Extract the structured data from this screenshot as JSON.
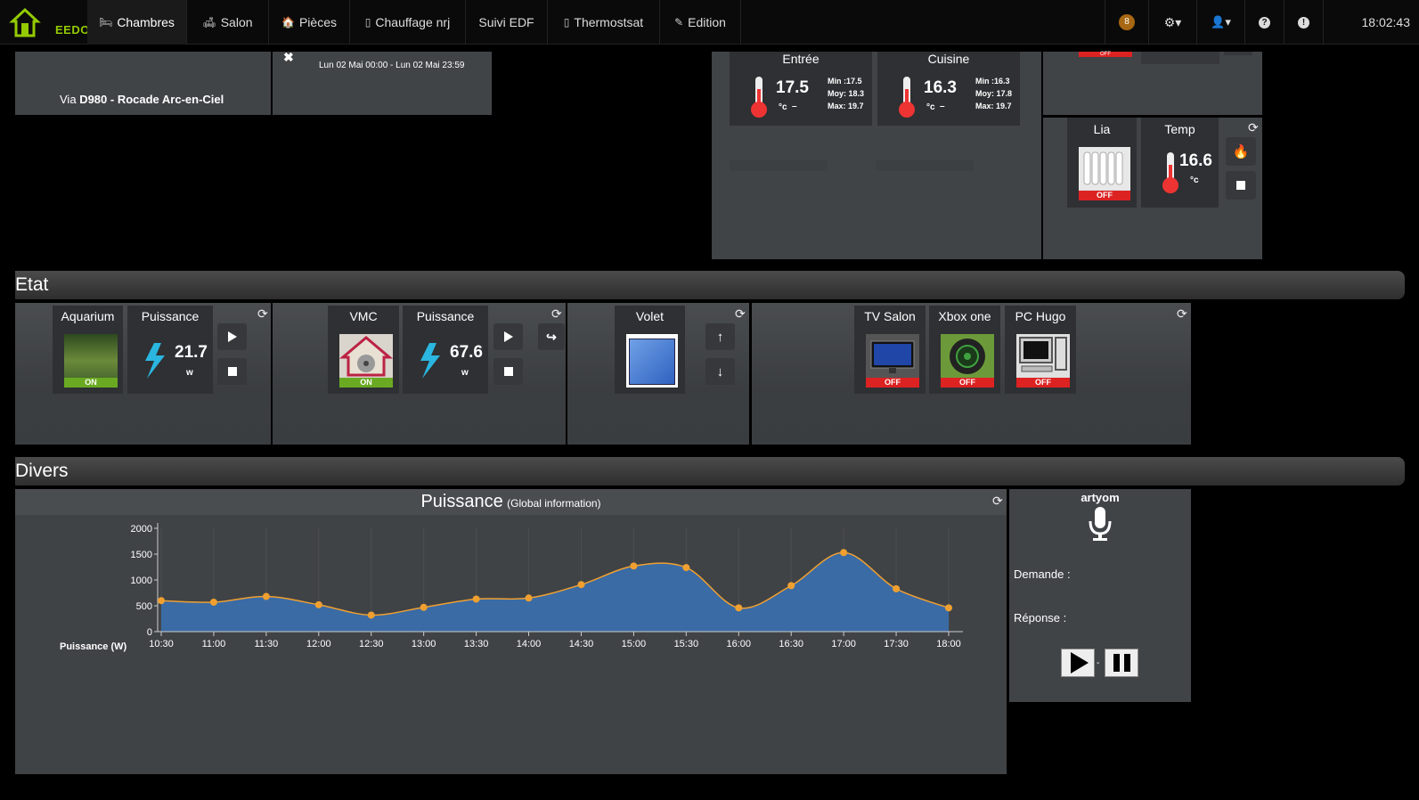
{
  "navbar": {
    "logo_text": "EEDOM",
    "items": [
      {
        "label": "Chambres",
        "glyph": "🛏"
      },
      {
        "label": "Salon",
        "glyph": "🛋"
      },
      {
        "label": "Pièces",
        "glyph": "🏠"
      },
      {
        "label": "Chauffage nrj",
        "glyph": "▯"
      },
      {
        "label": "Suivi EDF",
        "glyph": ""
      },
      {
        "label": "Thermostsat",
        "glyph": "▯"
      },
      {
        "label": "Edition",
        "glyph": "✎"
      }
    ],
    "notification_count": "8",
    "clock": "18:02:43"
  },
  "traffic": {
    "via": "Via",
    "road": "D980 - Rocade Arc-en-Ciel"
  },
  "agenda": {
    "range": "Lun 02 Mai 00:00 - Lun 02 Mai 23:59"
  },
  "temps": [
    {
      "label": "Entrée",
      "value": "17.5",
      "unit": "°c",
      "trend": "–",
      "min": "Min :17.5",
      "moy": "Moy: 18.3",
      "max": "Max: 19.7"
    },
    {
      "label": "Cuisine",
      "value": "16.3",
      "unit": "°c",
      "trend": "–",
      "min": "Min :16.3",
      "moy": "Moy: 17.8",
      "max": "Max: 19.7"
    }
  ],
  "top_right": {
    "off_label": "OFF"
  },
  "heating": {
    "lia_label": "Lia",
    "lia_state": "OFF",
    "temp_label": "Temp",
    "temp_value": "16.6",
    "temp_unit": "°c"
  },
  "etat": {
    "title": "Etat",
    "aquarium": {
      "label": "Aquarium",
      "state": "ON",
      "power_label": "Puissance",
      "power_value": "21.7",
      "power_unit": "w"
    },
    "vmc": {
      "label": "VMC",
      "state": "ON",
      "power_label": "Puissance",
      "power_value": "67.6",
      "power_unit": "w"
    },
    "volet": {
      "label": "Volet"
    },
    "devices": [
      {
        "label": "TV Salon",
        "state": "OFF"
      },
      {
        "label": "Xbox one",
        "state": "OFF"
      },
      {
        "label": "PC Hugo",
        "state": "OFF"
      }
    ]
  },
  "divers": {
    "title": "Divers",
    "voice": {
      "user": "artyom",
      "demande": "Demande :",
      "reponse": "Réponse :",
      "separator": "-"
    }
  },
  "chart_data": {
    "type": "area",
    "title": "Puissance",
    "subtitle": "(Global information)",
    "series": [
      {
        "name": "Puissance (W)",
        "values": [
          600,
          570,
          680,
          520,
          320,
          470,
          630,
          650,
          910,
          1270,
          1240,
          460,
          890,
          1530,
          830,
          460
        ]
      }
    ],
    "x": [
      "10:30",
      "11:00",
      "11:30",
      "12:00",
      "12:30",
      "13:00",
      "13:30",
      "14:00",
      "14:30",
      "15:00",
      "15:30",
      "16:00",
      "16:30",
      "17:00",
      "17:30",
      "18:00"
    ],
    "y_ticks": [
      0,
      500,
      1000,
      1500,
      2000
    ],
    "ylim": [
      0,
      2000
    ],
    "legend": "bottom-left",
    "colors": {
      "fill": "#3a6ba5",
      "line": "#f0a030",
      "point": "#f0a030"
    }
  }
}
